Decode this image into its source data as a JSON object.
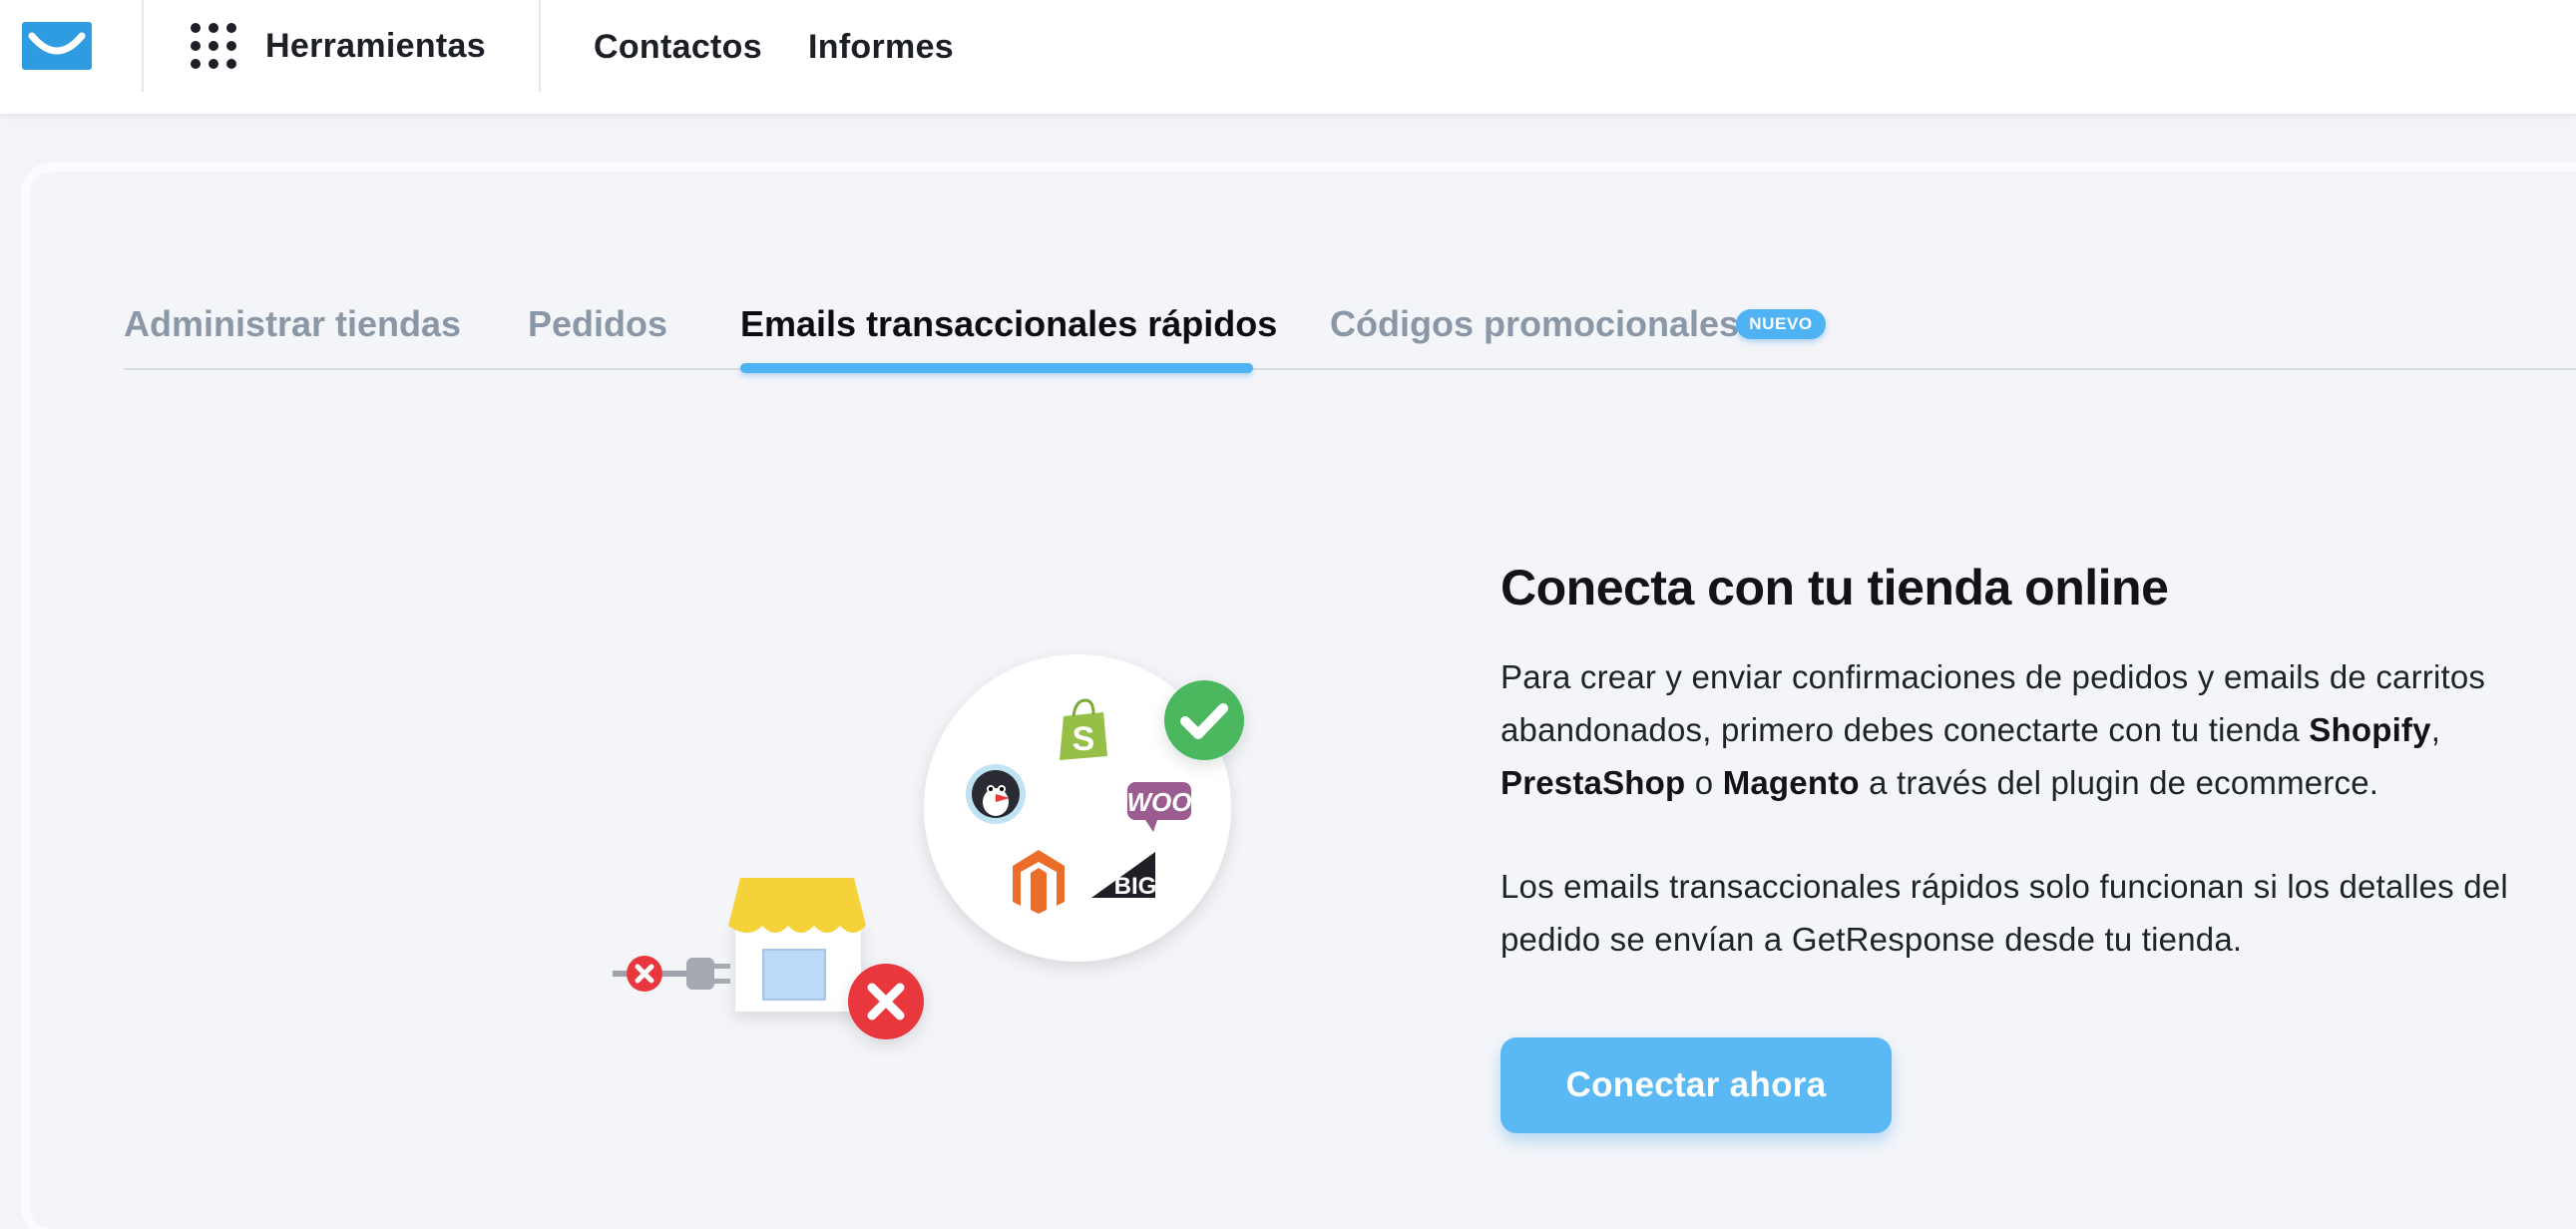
{
  "nav": {
    "logo_icon": "envelope-logo-icon",
    "tools_icon": "grid-icon",
    "tools_label": "Herramientas",
    "links": [
      "Contactos",
      "Informes"
    ]
  },
  "tabs": [
    {
      "label": "Administrar tiendas",
      "active": false
    },
    {
      "label": "Pedidos",
      "active": false
    },
    {
      "label": "Emails transaccionales rápidos",
      "active": true
    },
    {
      "label": "Códigos promocionales",
      "active": false,
      "badge": "NUEVO"
    }
  ],
  "content": {
    "headline": "Conecta con tu tienda online",
    "para1": {
      "prefix": "Para crear y enviar confirmaciones de pedidos y emails de carritos abandonados, primero debes conectarte con tu tienda ",
      "brand1": "Shopify",
      "sep1": ", ",
      "brand2": "PrestaShop",
      "sep2": " o ",
      "brand3": "Magento",
      "suffix": " a través del plugin de ecommerce."
    },
    "para2": "Los emails transaccionales rápidos solo funcionan si los detalles del pedido se envían a GetResponse desde tu tienda.",
    "button": "Conectar ahora"
  },
  "illustration": {
    "logos": [
      "shopify-icon",
      "prestashop-icon",
      "woocommerce-icon",
      "magento-icon",
      "bigcommerce-icon"
    ],
    "woo_text": "WOO",
    "big_text": "BIG",
    "icons": [
      "check-icon",
      "error-icon",
      "plug-icon",
      "store-icon"
    ]
  },
  "colors": {
    "accent": "#4fb3f3",
    "button": "#5ab8f4",
    "success": "#4cb860",
    "error": "#e8383d",
    "awning": "#f6d23a"
  }
}
